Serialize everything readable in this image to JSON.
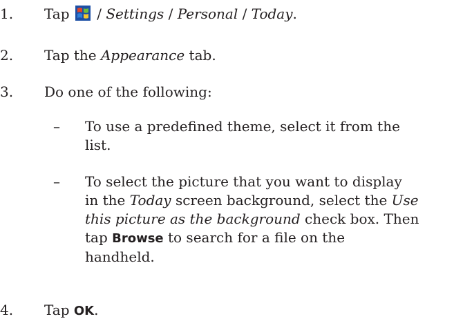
{
  "steps": [
    {
      "number": "1.",
      "parts": {
        "a": "Tap",
        "b": " / ",
        "c": "Settings",
        "d": " / ",
        "e": "Personal",
        "f": " / ",
        "g": "Today",
        "h": "."
      },
      "icon": "windows-start-icon"
    },
    {
      "number": "2.",
      "parts": {
        "a": "Tap the ",
        "b": "Appearance",
        "c": " tab."
      }
    },
    {
      "number": "3.",
      "text": "Do one of the following:",
      "subitems": [
        {
          "dash": "–",
          "line1": "To use a predefined theme, select it from the",
          "line2": "list."
        },
        {
          "dash": "–",
          "l1": "To select the picture that you want to display",
          "l2a": "in the ",
          "l2b": "Today",
          "l2c": " screen background, select the ",
          "l2d": "Use",
          "l3a": "this picture as the background",
          "l3b": " check box. Then",
          "l4a": "tap ",
          "l4b": "Browse",
          "l4c": " to search for a file on the",
          "l5": "handheld."
        }
      ]
    },
    {
      "number": "4.",
      "parts": {
        "a": "Tap ",
        "b": "OK",
        "c": "."
      }
    }
  ],
  "colors": {
    "text": "#231f20",
    "icon_red": "#e2452a",
    "icon_green": "#6cbd3c",
    "icon_blue": "#2f7fd8",
    "icon_yellow": "#f7c62f"
  }
}
